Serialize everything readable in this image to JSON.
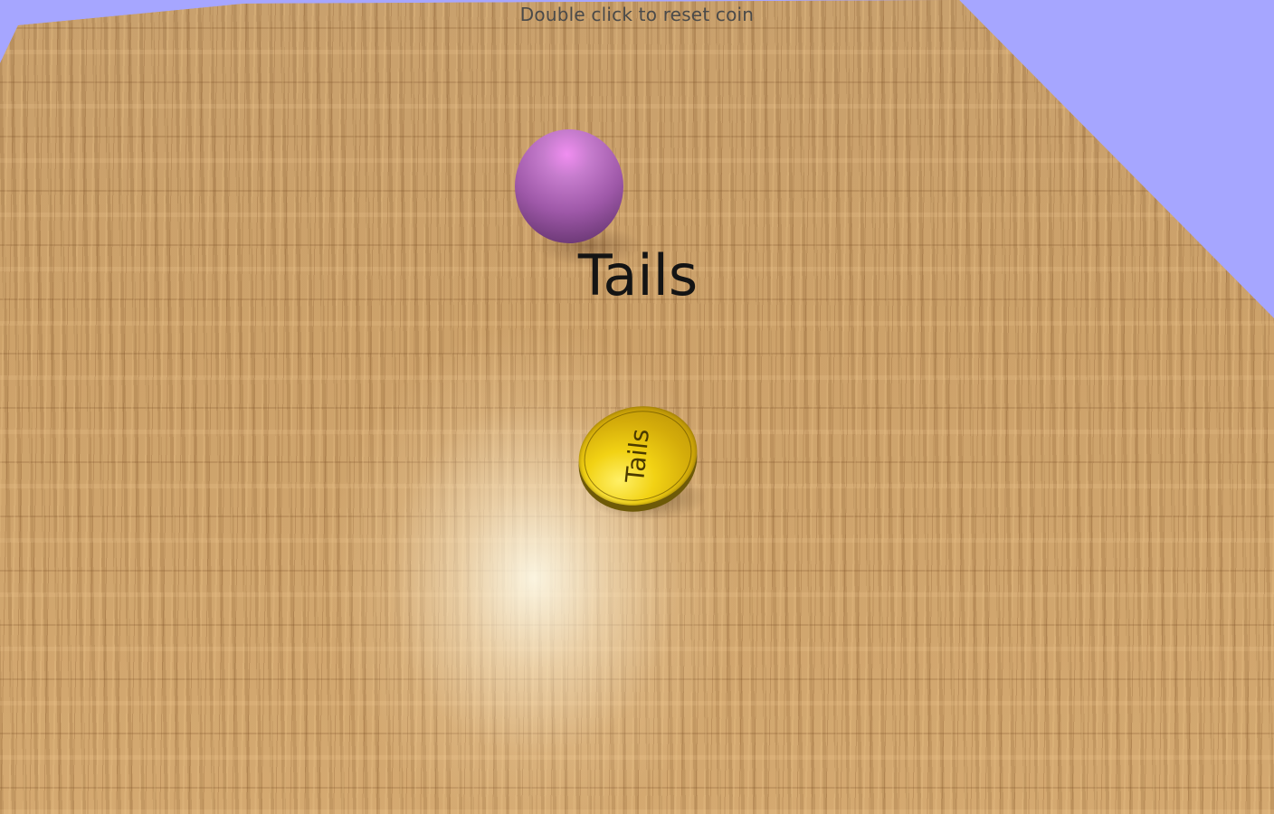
{
  "hud": {
    "instruction": "Double click to reset coin"
  },
  "result": {
    "label": "Tails"
  },
  "coin": {
    "face_text": "Tails",
    "color": "#e8c510"
  },
  "ball": {
    "color": "#b06bb8"
  },
  "colors": {
    "sky": "#a6a6ff",
    "table": "#c99a62"
  }
}
